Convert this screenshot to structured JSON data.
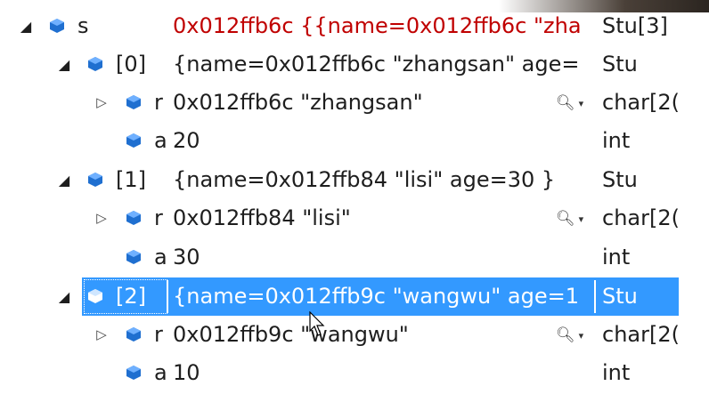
{
  "rows": [
    {
      "name": "s",
      "value": "0x012ffb6c {{name=0x012ffb6c \"zha",
      "type": "Stu[3]"
    },
    {
      "name": "[0]",
      "value": "{name=0x012ffb6c \"zhangsan\" age=",
      "type": "Stu"
    },
    {
      "name": "r",
      "value": "0x012ffb6c \"zhangsan\"",
      "type": "char[2("
    },
    {
      "name": "a",
      "value": "20",
      "type": "int"
    },
    {
      "name": "[1]",
      "value": "{name=0x012ffb84 \"lisi\" age=30 }",
      "type": "Stu"
    },
    {
      "name": "r",
      "value": "0x012ffb84 \"lisi\"",
      "type": "char[2("
    },
    {
      "name": "a",
      "value": "30",
      "type": "int"
    },
    {
      "name": "[2]",
      "value": "{name=0x012ffb9c \"wangwu\" age=1",
      "type": "Stu"
    },
    {
      "name": "r",
      "value": "0x012ffb9c \"wangwu\"",
      "type": "char[2("
    },
    {
      "name": "a",
      "value": "10",
      "type": "int"
    }
  ],
  "colors": {
    "selection": "#3399ff",
    "changed_value": "#c00000",
    "icon_blue": "#1f6fd0"
  },
  "icons": {
    "expanded": "expanded-triangle-icon",
    "collapsed": "collapsed-triangle-icon",
    "object": "object-icon",
    "viewer": "magnifier-icon"
  }
}
